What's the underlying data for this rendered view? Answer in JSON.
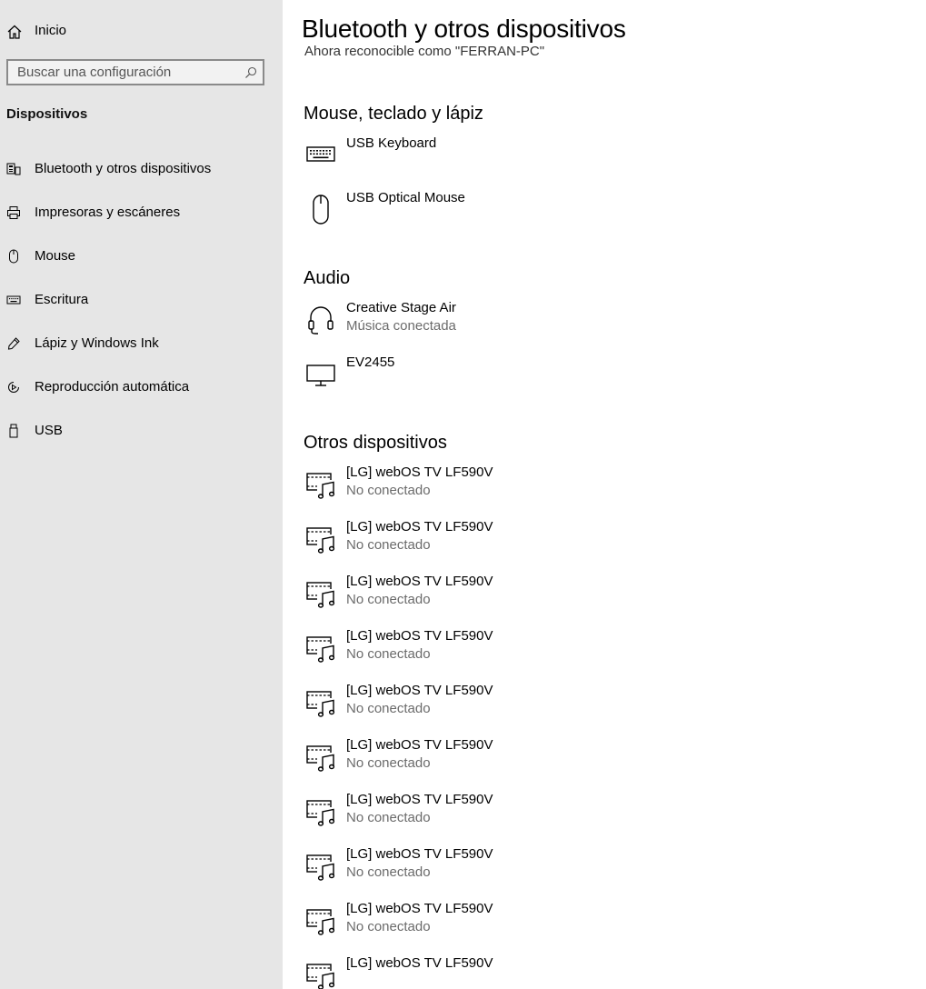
{
  "sidebar": {
    "home_label": "Inicio",
    "search_placeholder": "Buscar una configuración",
    "section_title": "Dispositivos",
    "items": [
      {
        "label": "Bluetooth y otros dispositivos",
        "icon": "bluetooth-devices-icon"
      },
      {
        "label": "Impresoras y escáneres",
        "icon": "printer-icon"
      },
      {
        "label": "Mouse",
        "icon": "mouse-icon"
      },
      {
        "label": "Escritura",
        "icon": "keyboard-icon"
      },
      {
        "label": "Lápiz y Windows Ink",
        "icon": "pen-icon"
      },
      {
        "label": "Reproducción automática",
        "icon": "autoplay-icon"
      },
      {
        "label": "USB",
        "icon": "usb-icon"
      }
    ]
  },
  "main": {
    "title": "Bluetooth y otros dispositivos",
    "discoverable_text": "Ahora reconocible como \"FERRAN-PC\"",
    "groups": [
      {
        "title": "Mouse, teclado y lápiz",
        "devices": [
          {
            "name": "USB Keyboard",
            "status": "",
            "icon": "keyboard-icon"
          },
          {
            "name": "USB Optical Mouse",
            "status": "",
            "icon": "mouse-icon"
          }
        ]
      },
      {
        "title": "Audio",
        "devices": [
          {
            "name": "Creative Stage Air",
            "status": "Música conectada",
            "icon": "headset-icon"
          },
          {
            "name": "EV2455",
            "status": "",
            "icon": "monitor-icon"
          }
        ]
      },
      {
        "title": "Otros dispositivos",
        "devices": [
          {
            "name": "[LG] webOS TV LF590V",
            "status": "No conectado",
            "icon": "media-device-icon"
          },
          {
            "name": "[LG] webOS TV LF590V",
            "status": "No conectado",
            "icon": "media-device-icon"
          },
          {
            "name": "[LG] webOS TV LF590V",
            "status": "No conectado",
            "icon": "media-device-icon"
          },
          {
            "name": "[LG] webOS TV LF590V",
            "status": "No conectado",
            "icon": "media-device-icon"
          },
          {
            "name": "[LG] webOS TV LF590V",
            "status": "No conectado",
            "icon": "media-device-icon"
          },
          {
            "name": "[LG] webOS TV LF590V",
            "status": "No conectado",
            "icon": "media-device-icon"
          },
          {
            "name": "[LG] webOS TV LF590V",
            "status": "No conectado",
            "icon": "media-device-icon"
          },
          {
            "name": "[LG] webOS TV LF590V",
            "status": "No conectado",
            "icon": "media-device-icon"
          },
          {
            "name": "[LG] webOS TV LF590V",
            "status": "No conectado",
            "icon": "media-device-icon"
          },
          {
            "name": "[LG] webOS TV LF590V",
            "status": "",
            "icon": "media-device-icon"
          }
        ]
      }
    ]
  }
}
